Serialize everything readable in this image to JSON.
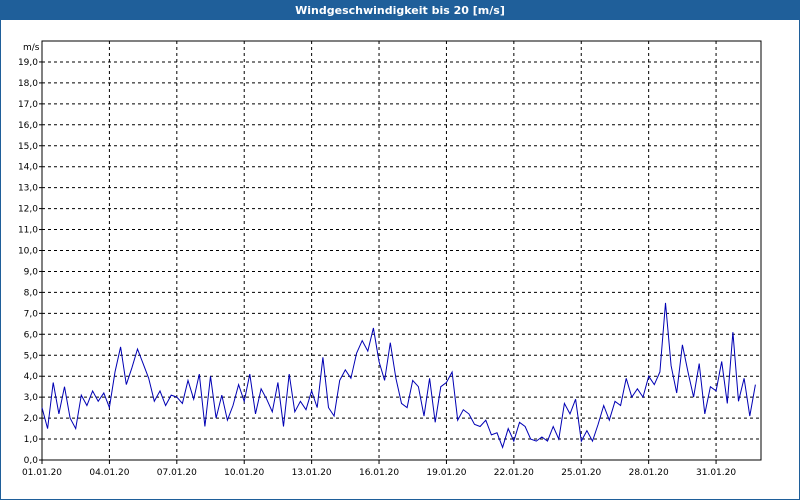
{
  "window": {
    "title": "Windgeschwindigkeit bis 20 [m/s]"
  },
  "colors": {
    "titlebar": "#1f5f9a",
    "series": "#0000b4",
    "grid": "#000000",
    "axis": "#000000"
  },
  "chart_data": {
    "type": "line",
    "title": "Windgeschwindigkeit bis 20 [m/s]",
    "ylabel": "m/s",
    "xlabel": "",
    "ylim": [
      0,
      20
    ],
    "xlim": [
      "2020-01-01",
      "2020-02-02"
    ],
    "grid": true,
    "y_ticks": [
      "0,0",
      "1,0",
      "2,0",
      "3,0",
      "4,0",
      "5,0",
      "6,0",
      "7,0",
      "8,0",
      "9,0",
      "10,0",
      "11,0",
      "12,0",
      "13,0",
      "14,0",
      "15,0",
      "16,0",
      "17,0",
      "18,0",
      "19,0"
    ],
    "x_ticks": [
      {
        "date": "2020-01-01",
        "label": "01.01.20"
      },
      {
        "date": "2020-01-04",
        "label": "04.01.20"
      },
      {
        "date": "2020-01-07",
        "label": "07.01.20"
      },
      {
        "date": "2020-01-10",
        "label": "10.01.20"
      },
      {
        "date": "2020-01-13",
        "label": "13.01.20"
      },
      {
        "date": "2020-01-16",
        "label": "16.01.20"
      },
      {
        "date": "2020-01-19",
        "label": "19.01.20"
      },
      {
        "date": "2020-01-22",
        "label": "22.01.20"
      },
      {
        "date": "2020-01-25",
        "label": "25.01.20"
      },
      {
        "date": "2020-01-28",
        "label": "28.01.20"
      },
      {
        "date": "2020-01-31",
        "label": "31.01.20"
      }
    ],
    "series": [
      {
        "x": [
          "2020-01-01 00:00",
          "2020-01-01 06:00",
          "2020-01-01 12:00",
          "2020-01-01 18:00",
          "2020-01-02 00:00",
          "2020-01-02 06:00",
          "2020-01-02 12:00",
          "2020-01-02 18:00",
          "2020-01-03 00:00",
          "2020-01-03 06:00",
          "2020-01-03 12:00",
          "2020-01-03 18:00",
          "2020-01-04 00:00",
          "2020-01-04 06:00",
          "2020-01-04 12:00",
          "2020-01-04 18:00",
          "2020-01-05 00:00",
          "2020-01-05 06:00",
          "2020-01-05 12:00",
          "2020-01-05 18:00",
          "2020-01-06 00:00",
          "2020-01-06 06:00",
          "2020-01-06 12:00",
          "2020-01-06 18:00",
          "2020-01-07 00:00",
          "2020-01-07 06:00",
          "2020-01-07 12:00",
          "2020-01-07 18:00",
          "2020-01-08 00:00",
          "2020-01-08 06:00",
          "2020-01-08 12:00",
          "2020-01-08 18:00",
          "2020-01-09 00:00",
          "2020-01-09 06:00",
          "2020-01-09 12:00",
          "2020-01-09 18:00",
          "2020-01-10 00:00",
          "2020-01-10 06:00",
          "2020-01-10 12:00",
          "2020-01-10 18:00",
          "2020-01-11 00:00",
          "2020-01-11 06:00",
          "2020-01-11 12:00",
          "2020-01-11 18:00",
          "2020-01-12 00:00",
          "2020-01-12 06:00",
          "2020-01-12 12:00",
          "2020-01-12 18:00",
          "2020-01-13 00:00",
          "2020-01-13 06:00",
          "2020-01-13 12:00",
          "2020-01-13 18:00",
          "2020-01-14 00:00",
          "2020-01-14 06:00",
          "2020-01-14 12:00",
          "2020-01-14 18:00",
          "2020-01-15 00:00",
          "2020-01-15 06:00",
          "2020-01-15 12:00",
          "2020-01-15 18:00",
          "2020-01-16 00:00",
          "2020-01-16 06:00",
          "2020-01-16 12:00",
          "2020-01-16 18:00",
          "2020-01-17 00:00",
          "2020-01-17 06:00",
          "2020-01-17 12:00",
          "2020-01-17 18:00",
          "2020-01-18 00:00",
          "2020-01-18 06:00",
          "2020-01-18 12:00",
          "2020-01-18 18:00",
          "2020-01-19 00:00",
          "2020-01-19 06:00",
          "2020-01-19 12:00",
          "2020-01-19 18:00",
          "2020-01-20 00:00",
          "2020-01-20 06:00",
          "2020-01-20 12:00",
          "2020-01-20 18:00",
          "2020-01-21 00:00",
          "2020-01-21 06:00",
          "2020-01-21 12:00",
          "2020-01-21 18:00",
          "2020-01-22 00:00",
          "2020-01-22 06:00",
          "2020-01-22 12:00",
          "2020-01-22 18:00",
          "2020-01-23 00:00",
          "2020-01-23 06:00",
          "2020-01-23 12:00",
          "2020-01-23 18:00",
          "2020-01-24 00:00",
          "2020-01-24 06:00",
          "2020-01-24 12:00",
          "2020-01-24 18:00",
          "2020-01-25 00:00",
          "2020-01-25 06:00",
          "2020-01-25 12:00",
          "2020-01-25 18:00",
          "2020-01-26 00:00",
          "2020-01-26 06:00",
          "2020-01-26 12:00",
          "2020-01-26 18:00",
          "2020-01-27 00:00",
          "2020-01-27 06:00",
          "2020-01-27 12:00",
          "2020-01-27 18:00",
          "2020-01-28 00:00",
          "2020-01-28 06:00",
          "2020-01-28 12:00",
          "2020-01-28 18:00",
          "2020-01-29 00:00",
          "2020-01-29 06:00",
          "2020-01-29 12:00",
          "2020-01-29 18:00",
          "2020-01-30 00:00",
          "2020-01-30 06:00",
          "2020-01-30 12:00",
          "2020-01-30 18:00",
          "2020-01-31 00:00",
          "2020-01-31 06:00",
          "2020-01-31 12:00",
          "2020-01-31 18:00",
          "2020-02-01 00:00",
          "2020-02-01 06:00",
          "2020-02-01 12:00",
          "2020-02-01 18:00"
        ],
        "y": [
          2.5,
          1.5,
          3.7,
          2.2,
          3.5,
          2.0,
          1.5,
          3.1,
          2.6,
          3.3,
          2.8,
          3.2,
          2.5,
          4.2,
          5.4,
          3.6,
          4.4,
          5.3,
          4.6,
          3.9,
          2.8,
          3.3,
          2.6,
          3.1,
          3.0,
          2.7,
          3.8,
          2.9,
          4.1,
          1.6,
          4.0,
          2.0,
          3.1,
          1.9,
          2.6,
          3.6,
          2.8,
          4.1,
          2.2,
          3.4,
          2.9,
          2.3,
          3.7,
          1.6,
          4.1,
          2.3,
          2.8,
          2.4,
          3.3,
          2.5,
          4.9,
          2.5,
          2.1,
          3.8,
          4.3,
          3.9,
          5.1,
          5.7,
          5.2,
          6.3,
          4.7,
          3.8,
          5.6,
          3.9,
          2.7,
          2.5,
          3.8,
          3.5,
          2.1,
          3.9,
          1.8,
          3.5,
          3.7,
          4.2,
          1.9,
          2.4,
          2.2,
          1.7,
          1.6,
          1.9,
          1.2,
          1.3,
          0.6,
          1.5,
          0.9,
          1.8,
          1.6,
          1.0,
          0.9,
          1.1,
          0.9,
          1.6,
          1.0,
          2.7,
          2.2,
          2.9,
          0.9,
          1.4,
          0.9,
          1.7,
          2.6,
          1.9,
          2.8,
          2.6,
          3.9,
          3.0,
          3.4,
          3.0,
          4.0,
          3.6,
          4.2,
          7.5,
          4.5,
          3.2,
          5.5,
          4.2,
          3.0,
          4.6,
          2.2,
          3.5,
          3.3,
          4.7,
          2.7,
          6.1,
          2.8,
          3.9,
          2.1,
          3.6
        ]
      }
    ]
  }
}
